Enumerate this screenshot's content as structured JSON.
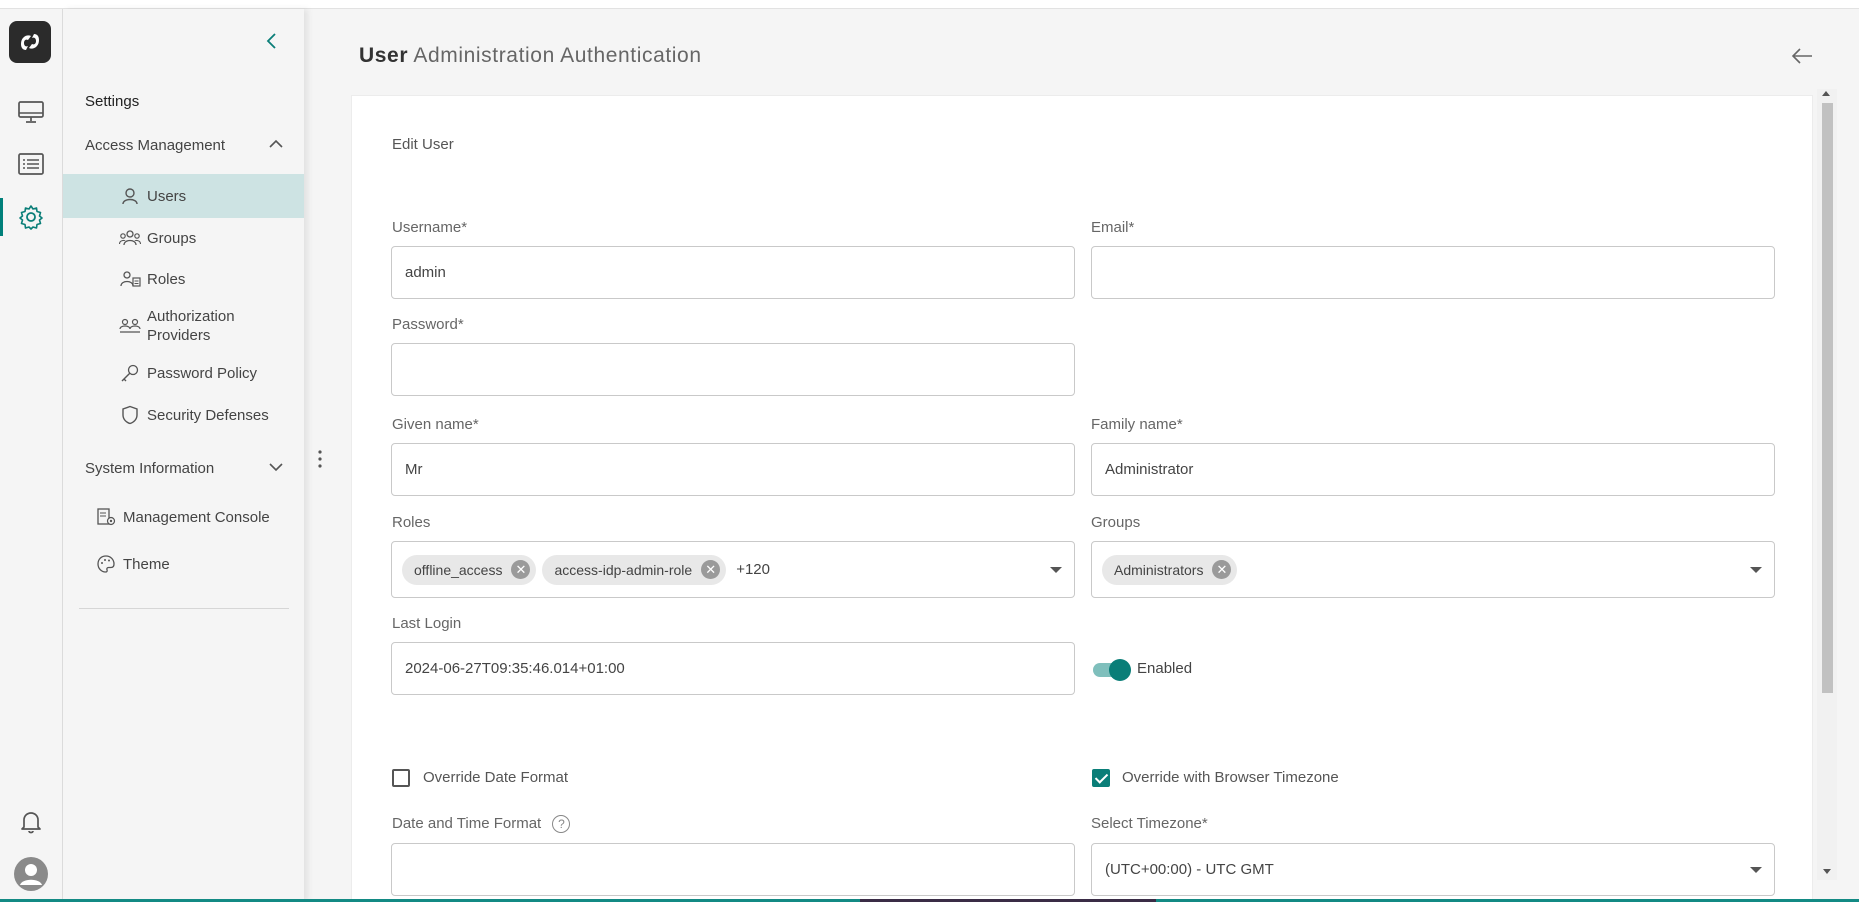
{
  "header": {
    "title_strong": "User",
    "title_rest": "Administration Authentication"
  },
  "sidebar": {
    "title": "Settings",
    "access_management": "Access Management",
    "items": [
      {
        "label": "Users",
        "icon": "user-icon"
      },
      {
        "label": "Groups",
        "icon": "groups-icon"
      },
      {
        "label": "Roles",
        "icon": "roles-icon"
      },
      {
        "label": "Authorization Providers",
        "icon": "authorization-providers-icon"
      },
      {
        "label": "Password Policy",
        "icon": "key-icon"
      },
      {
        "label": "Security Defenses",
        "icon": "shield-icon"
      }
    ],
    "system_information": "System Information",
    "extra_items": [
      {
        "label": "Management Console",
        "icon": "management-console-icon"
      },
      {
        "label": "Theme",
        "icon": "palette-icon"
      }
    ]
  },
  "form": {
    "card_title": "Edit User",
    "username_label": "Username*",
    "username_value": "admin",
    "email_label": "Email*",
    "email_value": "",
    "password_label": "Password*",
    "password_value": "",
    "given_name_label": "Given name*",
    "given_name_value": "Mr",
    "family_name_label": "Family name*",
    "family_name_value": "Administrator",
    "roles_label": "Roles",
    "roles_chips": [
      "offline_access",
      "access-idp-admin-role"
    ],
    "roles_more": "+120",
    "groups_label": "Groups",
    "groups_chips": [
      "Administrators"
    ],
    "last_login_label": "Last Login",
    "last_login_value": "2024-06-27T09:35:46.014+01:00",
    "enabled_label": "Enabled",
    "enabled": true,
    "override_date_format_label": "Override Date Format",
    "override_date_format": false,
    "override_browser_tz_label": "Override with Browser Timezone",
    "override_browser_tz": true,
    "date_time_format_label": "Date and Time Format",
    "date_time_format_value": "",
    "timezone_label": "Select Timezone*",
    "timezone_value": "(UTC+00:00) - UTC GMT"
  },
  "colors": {
    "accent": "#0a7e78",
    "active_item_bg": "#cde3e3"
  }
}
